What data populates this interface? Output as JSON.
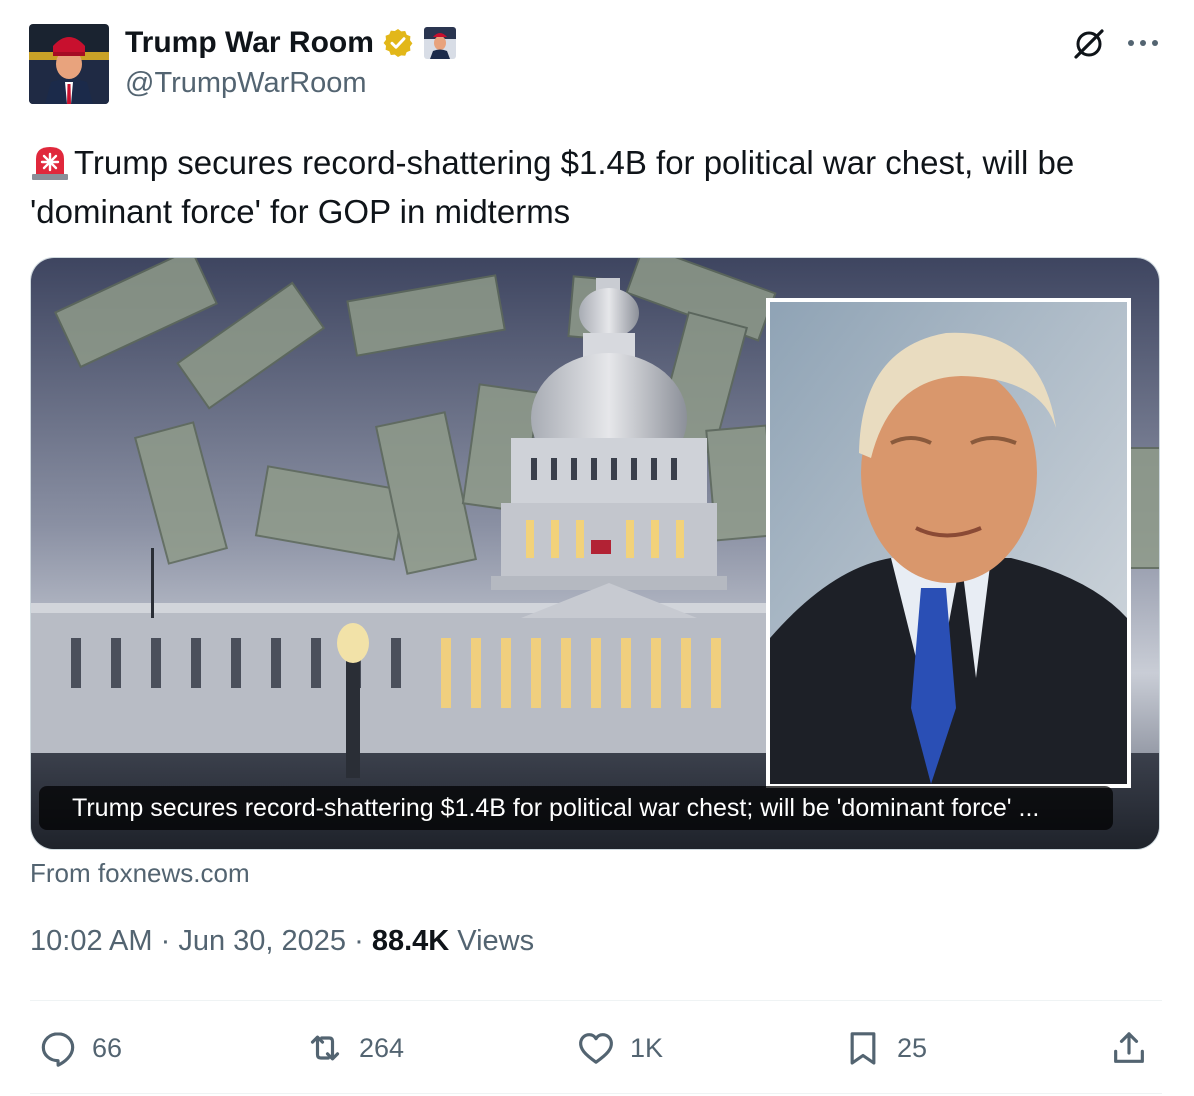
{
  "author": {
    "name": "Trump War Room",
    "handle": "@TrumpWarRoom"
  },
  "icons": {
    "verified": "verified-badge-icon",
    "grok": "grok-icon",
    "more": "more-options-icon",
    "siren": "siren-emoji-icon",
    "reply": "reply-icon",
    "retweet": "retweet-icon",
    "like": "like-icon",
    "bookmark": "bookmark-icon",
    "share": "share-icon"
  },
  "tweet": {
    "text": "Trump secures record-shattering $1.4B for political war chest, will be 'dominant force' for GOP in midterms"
  },
  "card": {
    "caption": "Trump secures record-shattering $1.4B for political war chest; will be 'dominant force' ...",
    "source": "From foxnews.com"
  },
  "meta": {
    "time": "10:02 AM",
    "separator": "·",
    "date": "Jun 30, 2025",
    "views_count": "88.4K",
    "views_label": "Views"
  },
  "actions": {
    "replies": "66",
    "retweets": "264",
    "likes": "1K",
    "bookmarks": "25"
  },
  "colors": {
    "text": "#0f1419",
    "secondary": "#536471",
    "verified": "#e2b719",
    "divider": "#eff3f4"
  }
}
